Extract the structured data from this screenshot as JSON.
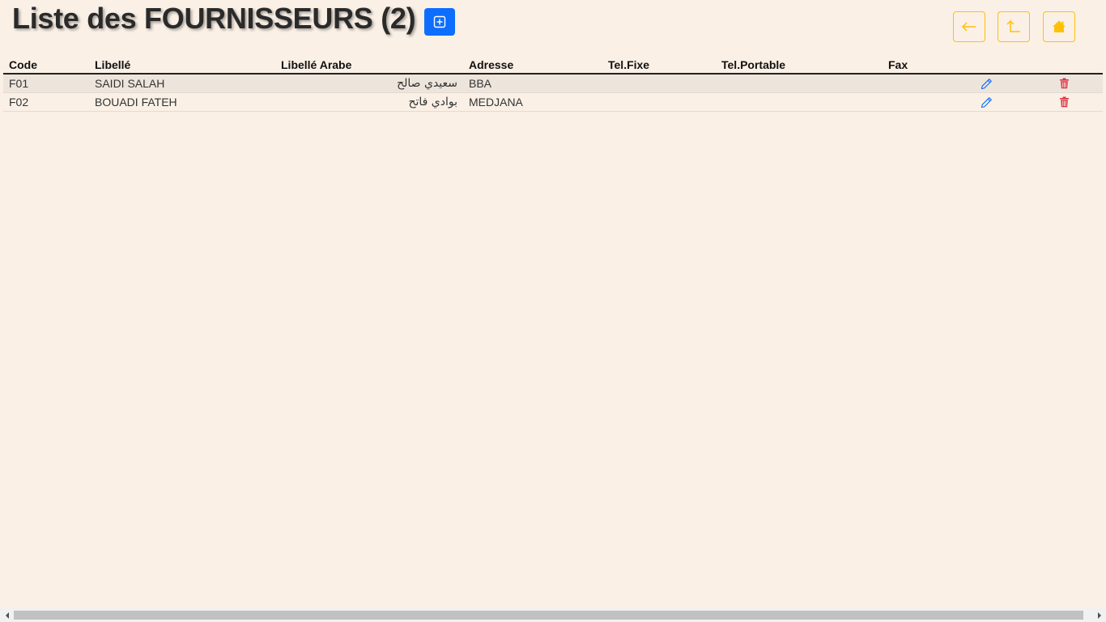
{
  "header": {
    "title": "Liste des FOURNISSEURS (2)"
  },
  "toolbar": {
    "add_icon": "plus-square-icon",
    "back_icon": "arrow-left-icon",
    "up_icon": "arrow-up-icon",
    "home_icon": "home-icon"
  },
  "colors": {
    "background": "#faf0e6",
    "primary": "#0d6efd",
    "warning": "#ffc107",
    "edit": "#0d6efd",
    "delete": "#dc3545"
  },
  "table": {
    "columns": {
      "code": "Code",
      "libelle": "Libellé",
      "libelle_arabe": "Libellé Arabe",
      "adresse": "Adresse",
      "tel_fixe": "Tel.Fixe",
      "tel_portable": "Tel.Portable",
      "fax": "Fax"
    },
    "rows": [
      {
        "code": "F01",
        "libelle": "SAIDI SALAH",
        "libelle_arabe": "سعيدي صالح",
        "adresse": "BBA",
        "tel_fixe": "",
        "tel_portable": "",
        "fax": ""
      },
      {
        "code": "F02",
        "libelle": "BOUADI FATEH",
        "libelle_arabe": "بوادي فاتح",
        "adresse": "MEDJANA",
        "tel_fixe": "",
        "tel_portable": "",
        "fax": ""
      }
    ]
  }
}
